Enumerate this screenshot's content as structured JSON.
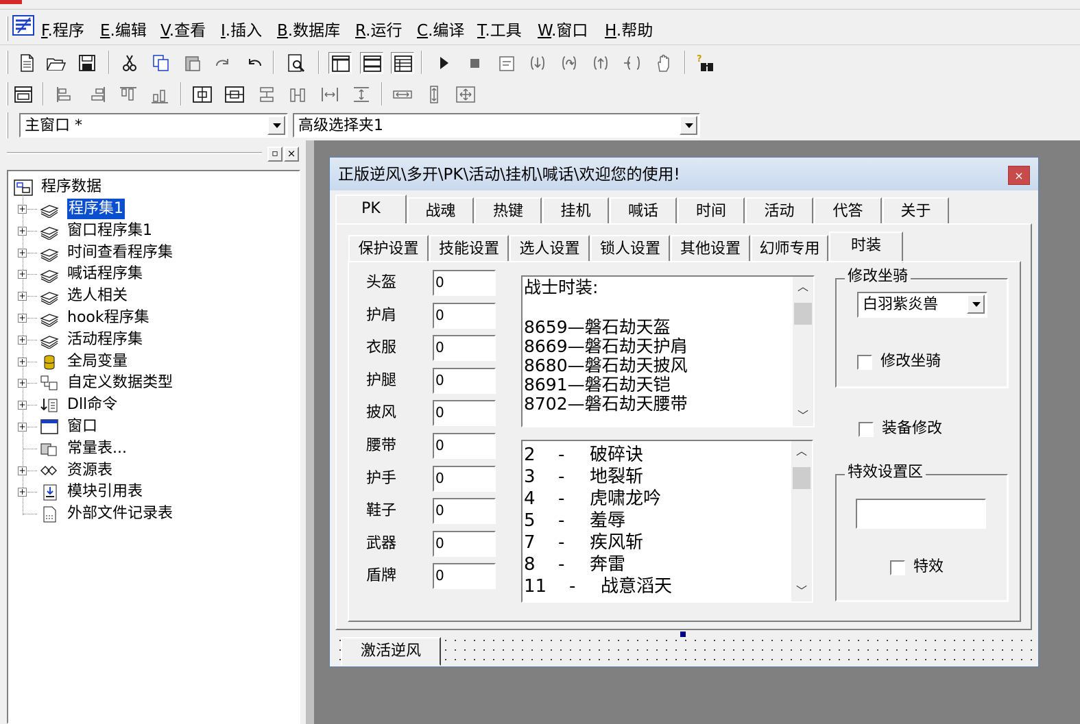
{
  "menu": {
    "items": [
      {
        "key": "F",
        "label": ".程序"
      },
      {
        "key": "E",
        "label": ".编辑"
      },
      {
        "key": "V",
        "label": ".查看"
      },
      {
        "key": "I",
        "label": ".插入"
      },
      {
        "key": "B",
        "label": ".数据库"
      },
      {
        "key": "R",
        "label": ".运行"
      },
      {
        "key": "C",
        "label": ".编译"
      },
      {
        "key": "T",
        "label": ".工具"
      },
      {
        "key": "W",
        "label": ".窗口"
      },
      {
        "key": "H",
        "label": ".帮助"
      }
    ]
  },
  "toolbar1": {
    "icons": [
      "new-file-icon",
      "open-folder-icon",
      "save-icon",
      "cut-icon",
      "copy-icon",
      "paste-icon",
      "redo-icon",
      "undo-icon",
      "find-icon",
      "layout-1-icon",
      "layout-2-icon",
      "layout-3-icon",
      "run-icon",
      "stop-icon",
      "step-icon",
      "step-into-icon",
      "step-over-icon",
      "step-out-icon",
      "run-to-cursor-icon",
      "hand-icon",
      "help-find-icon"
    ]
  },
  "toolbar2": {
    "icons": [
      "form-icon",
      "align-left-icon",
      "align-right-icon",
      "align-top-icon",
      "align-bottom-icon",
      "center-h-icon",
      "center-v-icon",
      "same-width-icon",
      "same-height-icon",
      "h-spacing-icon",
      "v-spacing-icon",
      "stretch-h-icon",
      "stretch-v-icon",
      "move-icon"
    ]
  },
  "combo": {
    "window_selector": "主窗口 *",
    "component_selector": "高级选择夹1"
  },
  "tree": {
    "root": "程序数据",
    "items": [
      {
        "label": "程序集1",
        "icon": "module-icon",
        "selected": true
      },
      {
        "label": "窗口程序集1",
        "icon": "module-icon"
      },
      {
        "label": "时间查看程序集",
        "icon": "module-icon"
      },
      {
        "label": "喊话程序集",
        "icon": "module-icon"
      },
      {
        "label": "选人相关",
        "icon": "module-icon"
      },
      {
        "label": "hook程序集",
        "icon": "module-icon"
      },
      {
        "label": "活动程序集",
        "icon": "module-icon"
      },
      {
        "label": "全局变量",
        "icon": "global-var-icon"
      },
      {
        "label": "自定义数据类型",
        "icon": "data-type-icon"
      },
      {
        "label": "Dll命令",
        "icon": "dll-icon"
      },
      {
        "label": "窗口",
        "icon": "window-icon"
      },
      {
        "label": "常量表...",
        "icon": "const-icon"
      },
      {
        "label": "资源表",
        "icon": "resource-icon"
      },
      {
        "label": "模块引用表",
        "icon": "module-ref-icon"
      },
      {
        "label": "外部文件记录表",
        "icon": "external-file-icon"
      }
    ]
  },
  "form": {
    "title": "正版逆风\\多开\\PK\\活动\\挂机\\喊话\\欢迎您的使用!",
    "close": "×",
    "main_tabs": [
      "PK",
      "战魂",
      "热键",
      "挂机",
      "喊话",
      "时间",
      "活动",
      "代答",
      "关于"
    ],
    "sub_tabs": [
      "保护设置",
      "技能设置",
      "选人设置",
      "锁人设置",
      "其他设置",
      "幻师专用",
      "时装"
    ],
    "fields": [
      {
        "label": "头盔",
        "value": "0"
      },
      {
        "label": "护肩",
        "value": "0"
      },
      {
        "label": "衣服",
        "value": "0"
      },
      {
        "label": "护腿",
        "value": "0"
      },
      {
        "label": "披风",
        "value": "0"
      },
      {
        "label": "腰带",
        "value": "0"
      },
      {
        "label": "护手",
        "value": "0"
      },
      {
        "label": "鞋子",
        "value": "0"
      },
      {
        "label": "武器",
        "value": "0"
      },
      {
        "label": "盾牌",
        "value": "0"
      }
    ],
    "fashion_text": {
      "heading": "战士时装:",
      "lines": [
        "8659—磐石劫天盔",
        "8669—磐石劫天护肩",
        "8680—磐石劫天披风",
        "8691—磐石劫天铠",
        "8702—磐石劫天腰带"
      ]
    },
    "skills_list": [
      {
        "id": "2",
        "sep": "-",
        "name": "破碎诀"
      },
      {
        "id": "3",
        "sep": "-",
        "name": "地裂斩"
      },
      {
        "id": "4",
        "sep": "-",
        "name": "虎啸龙吟"
      },
      {
        "id": "5",
        "sep": "-",
        "name": "羞辱"
      },
      {
        "id": "7",
        "sep": "-",
        "name": "疾风斩"
      },
      {
        "id": "8",
        "sep": "-",
        "name": "奔雷"
      },
      {
        "id": "11",
        "sep": "-",
        "name": "战意滔天"
      }
    ],
    "mount_group": {
      "title": "修改坐骑",
      "selected": "白羽紫炎兽",
      "checkbox_label": "修改坐骑"
    },
    "equip_checkbox_label": "装备修改",
    "effect_group": {
      "title": "特效设置区",
      "input_value": "",
      "checkbox_label": "特效"
    },
    "activate_button": "激活逆风"
  }
}
